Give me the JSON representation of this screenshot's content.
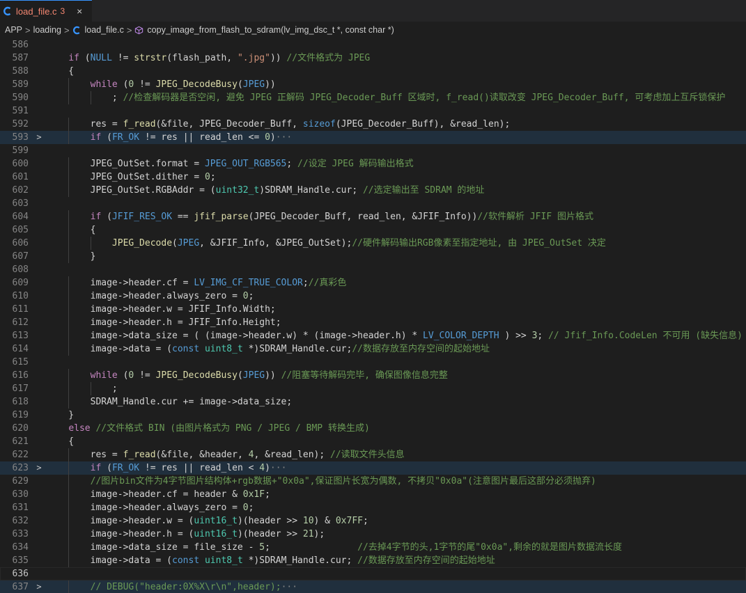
{
  "tab": {
    "icon": "c-language-icon",
    "filename": "load_file.c",
    "problem_count": "3",
    "close": "×"
  },
  "breadcrumb": {
    "items": [
      "APP",
      "loading",
      "load_file.c",
      "copy_image_from_flash_to_sdram(lv_img_dsc_t *, const char *)"
    ],
    "separator": ">"
  },
  "colors": {
    "background": "#1e1e1e",
    "keyword": "#c586c0",
    "type": "#569cd6",
    "function": "#dcdcaa",
    "string": "#ce9178",
    "number": "#b5cea8",
    "comment": "#6a9955",
    "error_tab": "#f48771"
  },
  "code": {
    "lines": [
      {
        "n": "586",
        "fold": "",
        "tokens": []
      },
      {
        "n": "587",
        "fold": "",
        "tokens": [
          [
            "    ",
            ""
          ],
          [
            "if",
            "kw"
          ],
          [
            " (",
            ""
          ],
          [
            "NULL",
            "mac"
          ],
          [
            " != ",
            ""
          ],
          [
            "strstr",
            "fn"
          ],
          [
            "(flash_path, ",
            ""
          ],
          [
            "\".jpg\"",
            "str"
          ],
          [
            ")) ",
            ""
          ],
          [
            "//文件格式为 JPEG",
            "cm"
          ]
        ]
      },
      {
        "n": "588",
        "fold": "",
        "tokens": [
          [
            "    {",
            ""
          ]
        ]
      },
      {
        "n": "589",
        "fold": "",
        "tokens": [
          [
            "        ",
            ""
          ],
          [
            "while",
            "kw"
          ],
          [
            " (",
            ""
          ],
          [
            "0",
            "num"
          ],
          [
            " != ",
            ""
          ],
          [
            "JPEG_DecodeBusy",
            "fn"
          ],
          [
            "(",
            ""
          ],
          [
            "JPEG",
            "mac"
          ],
          [
            "))",
            ""
          ]
        ]
      },
      {
        "n": "590",
        "fold": "",
        "tokens": [
          [
            "            ; ",
            ""
          ],
          [
            "//检查解码器是否空闲, 避免 JPEG 正解码 JPEG_Decoder_Buff 区域时, f_read()读取改变 JPEG_Decoder_Buff, 可考虑加上互斥锁保护",
            "cm"
          ]
        ]
      },
      {
        "n": "591",
        "fold": "",
        "tokens": []
      },
      {
        "n": "592",
        "fold": "",
        "tokens": [
          [
            "        res = ",
            ""
          ],
          [
            "f_read",
            "fn"
          ],
          [
            "(&file, JPEG_Decoder_Buff, ",
            ""
          ],
          [
            "sizeof",
            "kb"
          ],
          [
            "(JPEG_Decoder_Buff), &read_len);",
            ""
          ]
        ]
      },
      {
        "n": "593",
        "fold": ">",
        "tokens": [
          [
            "        ",
            ""
          ],
          [
            "if",
            "kw"
          ],
          [
            " (",
            ""
          ],
          [
            "FR_OK",
            "mac"
          ],
          [
            " != res || read_len <= ",
            ""
          ],
          [
            "0",
            "num"
          ],
          [
            ")",
            ""
          ],
          [
            "···",
            "ell"
          ]
        ]
      },
      {
        "n": "599",
        "fold": "",
        "tokens": []
      },
      {
        "n": "600",
        "fold": "",
        "tokens": [
          [
            "        JPEG_OutSet.format = ",
            ""
          ],
          [
            "JPEG_OUT_RGB565",
            "mac"
          ],
          [
            "; ",
            ""
          ],
          [
            "//设定 JPEG 解码输出格式",
            "cm"
          ]
        ]
      },
      {
        "n": "601",
        "fold": "",
        "tokens": [
          [
            "        JPEG_OutSet.dither = ",
            ""
          ],
          [
            "0",
            "num"
          ],
          [
            ";",
            ""
          ]
        ]
      },
      {
        "n": "602",
        "fold": "",
        "tokens": [
          [
            "        JPEG_OutSet.RGBAddr = (",
            ""
          ],
          [
            "uint32_t",
            "ty"
          ],
          [
            ")SDRAM_Handle.cur; ",
            ""
          ],
          [
            "//选定输出至 SDRAM 的地址",
            "cm"
          ]
        ]
      },
      {
        "n": "603",
        "fold": "",
        "tokens": []
      },
      {
        "n": "604",
        "fold": "",
        "tokens": [
          [
            "        ",
            ""
          ],
          [
            "if",
            "kw"
          ],
          [
            " (",
            ""
          ],
          [
            "JFIF_RES_OK",
            "mac"
          ],
          [
            " == ",
            ""
          ],
          [
            "jfif_parse",
            "fn"
          ],
          [
            "(JPEG_Decoder_Buff, read_len, &JFIF_Info))",
            ""
          ],
          [
            "//软件解析 JFIF 图片格式",
            "cm"
          ]
        ]
      },
      {
        "n": "605",
        "fold": "",
        "tokens": [
          [
            "        {",
            ""
          ]
        ]
      },
      {
        "n": "606",
        "fold": "",
        "tokens": [
          [
            "            ",
            ""
          ],
          [
            "JPEG_Decode",
            "fn"
          ],
          [
            "(",
            ""
          ],
          [
            "JPEG",
            "mac"
          ],
          [
            ", &JFIF_Info, &JPEG_OutSet);",
            ""
          ],
          [
            "//硬件解码输出RGB像素至指定地址, 由 JPEG_OutSet 决定",
            "cm"
          ]
        ]
      },
      {
        "n": "607",
        "fold": "",
        "tokens": [
          [
            "        }",
            ""
          ]
        ]
      },
      {
        "n": "608",
        "fold": "",
        "tokens": []
      },
      {
        "n": "609",
        "fold": "",
        "tokens": [
          [
            "        image->header.cf = ",
            ""
          ],
          [
            "LV_IMG_CF_TRUE_COLOR",
            "mac"
          ],
          [
            ";",
            ""
          ],
          [
            "//真彩色",
            "cm"
          ]
        ]
      },
      {
        "n": "610",
        "fold": "",
        "tokens": [
          [
            "        image->header.always_zero = ",
            ""
          ],
          [
            "0",
            "num"
          ],
          [
            ";",
            ""
          ]
        ]
      },
      {
        "n": "611",
        "fold": "",
        "tokens": [
          [
            "        image->header.w = JFIF_Info.Width;",
            ""
          ]
        ]
      },
      {
        "n": "612",
        "fold": "",
        "tokens": [
          [
            "        image->header.h = JFIF_Info.Height;",
            ""
          ]
        ]
      },
      {
        "n": "613",
        "fold": "",
        "tokens": [
          [
            "        image->data_size = ( (image->header.w) * (image->header.h) * ",
            ""
          ],
          [
            "LV_COLOR_DEPTH",
            "mac"
          ],
          [
            " ) >> ",
            ""
          ],
          [
            "3",
            "num"
          ],
          [
            "; ",
            ""
          ],
          [
            "// Jfif_Info.CodeLen 不可用 (缺失信息)",
            "cm"
          ]
        ]
      },
      {
        "n": "614",
        "fold": "",
        "tokens": [
          [
            "        image->data = (",
            ""
          ],
          [
            "const",
            "kb"
          ],
          [
            " ",
            ""
          ],
          [
            "uint8_t",
            "ty"
          ],
          [
            " *)SDRAM_Handle.cur;",
            ""
          ],
          [
            "//数据存放至内存空间的起始地址",
            "cm"
          ]
        ]
      },
      {
        "n": "615",
        "fold": "",
        "tokens": []
      },
      {
        "n": "616",
        "fold": "",
        "tokens": [
          [
            "        ",
            ""
          ],
          [
            "while",
            "kw"
          ],
          [
            " (",
            ""
          ],
          [
            "0",
            "num"
          ],
          [
            " != ",
            ""
          ],
          [
            "JPEG_DecodeBusy",
            "fn"
          ],
          [
            "(",
            ""
          ],
          [
            "JPEG",
            "mac"
          ],
          [
            ")) ",
            ""
          ],
          [
            "//阻塞等待解码完毕, 确保图像信息完整",
            "cm"
          ]
        ]
      },
      {
        "n": "617",
        "fold": "",
        "tokens": [
          [
            "            ;",
            ""
          ]
        ]
      },
      {
        "n": "618",
        "fold": "",
        "tokens": [
          [
            "        SDRAM_Handle.cur += image->data_size;",
            ""
          ]
        ]
      },
      {
        "n": "619",
        "fold": "",
        "tokens": [
          [
            "    }",
            ""
          ]
        ]
      },
      {
        "n": "620",
        "fold": "",
        "tokens": [
          [
            "    ",
            ""
          ],
          [
            "else",
            "kw"
          ],
          [
            " ",
            ""
          ],
          [
            "//文件格式 BIN (由图片格式为 PNG / JPEG / BMP 转换生成)",
            "cm"
          ]
        ]
      },
      {
        "n": "621",
        "fold": "",
        "tokens": [
          [
            "    {",
            ""
          ]
        ]
      },
      {
        "n": "622",
        "fold": "",
        "tokens": [
          [
            "        res = ",
            ""
          ],
          [
            "f_read",
            "fn"
          ],
          [
            "(&file, &header, ",
            ""
          ],
          [
            "4",
            "num"
          ],
          [
            ", &read_len); ",
            ""
          ],
          [
            "//读取文件头信息",
            "cm"
          ]
        ]
      },
      {
        "n": "623",
        "fold": ">",
        "tokens": [
          [
            "        ",
            ""
          ],
          [
            "if",
            "kw"
          ],
          [
            " (",
            ""
          ],
          [
            "FR_OK",
            "mac"
          ],
          [
            " != res || read_len < ",
            ""
          ],
          [
            "4",
            "num"
          ],
          [
            ")",
            ""
          ],
          [
            "···",
            "ell"
          ]
        ]
      },
      {
        "n": "629",
        "fold": "",
        "tokens": [
          [
            "        ",
            ""
          ],
          [
            "//图片bin文件为4字节图片结构体+rgb数据+\"0x0a\",保证图片长宽为偶数, 不拷贝\"0x0a\"(注意图片最后这部分必须抛弃)",
            "cm"
          ]
        ]
      },
      {
        "n": "630",
        "fold": "",
        "tokens": [
          [
            "        image->header.cf = header & ",
            ""
          ],
          [
            "0x1F",
            "num"
          ],
          [
            ";",
            ""
          ]
        ]
      },
      {
        "n": "631",
        "fold": "",
        "tokens": [
          [
            "        image->header.always_zero = ",
            ""
          ],
          [
            "0",
            "num"
          ],
          [
            ";",
            ""
          ]
        ]
      },
      {
        "n": "632",
        "fold": "",
        "tokens": [
          [
            "        image->header.w = (",
            ""
          ],
          [
            "uint16_t",
            "ty"
          ],
          [
            ")(header >> ",
            ""
          ],
          [
            "10",
            "num"
          ],
          [
            ") & ",
            ""
          ],
          [
            "0x7FF",
            "num"
          ],
          [
            ";",
            ""
          ]
        ]
      },
      {
        "n": "633",
        "fold": "",
        "tokens": [
          [
            "        image->header.h = (",
            ""
          ],
          [
            "uint16_t",
            "ty"
          ],
          [
            ")(header >> ",
            ""
          ],
          [
            "21",
            "num"
          ],
          [
            ");",
            ""
          ]
        ]
      },
      {
        "n": "634",
        "fold": "",
        "tokens": [
          [
            "        image->data_size = file_size - ",
            ""
          ],
          [
            "5",
            "num"
          ],
          [
            ";                ",
            ""
          ],
          [
            "//去掉4字节的头,1字节的尾\"0x0a\",剩余的就是图片数据流长度",
            "cm"
          ]
        ]
      },
      {
        "n": "635",
        "fold": "",
        "tokens": [
          [
            "        image->data = (",
            ""
          ],
          [
            "const",
            "kb"
          ],
          [
            " ",
            ""
          ],
          [
            "uint8_t",
            "ty"
          ],
          [
            " *)SDRAM_Handle.cur; ",
            ""
          ],
          [
            "//数据存放至内存空间的起始地址",
            "cm"
          ]
        ]
      },
      {
        "n": "636",
        "fold": "",
        "tokens": []
      },
      {
        "n": "637",
        "fold": ">",
        "tokens": [
          [
            "        ",
            ""
          ],
          [
            "// DEBUG(\"header:0X%X\\r\\n\",header);",
            "cm"
          ],
          [
            "···",
            "ell"
          ]
        ]
      }
    ]
  }
}
